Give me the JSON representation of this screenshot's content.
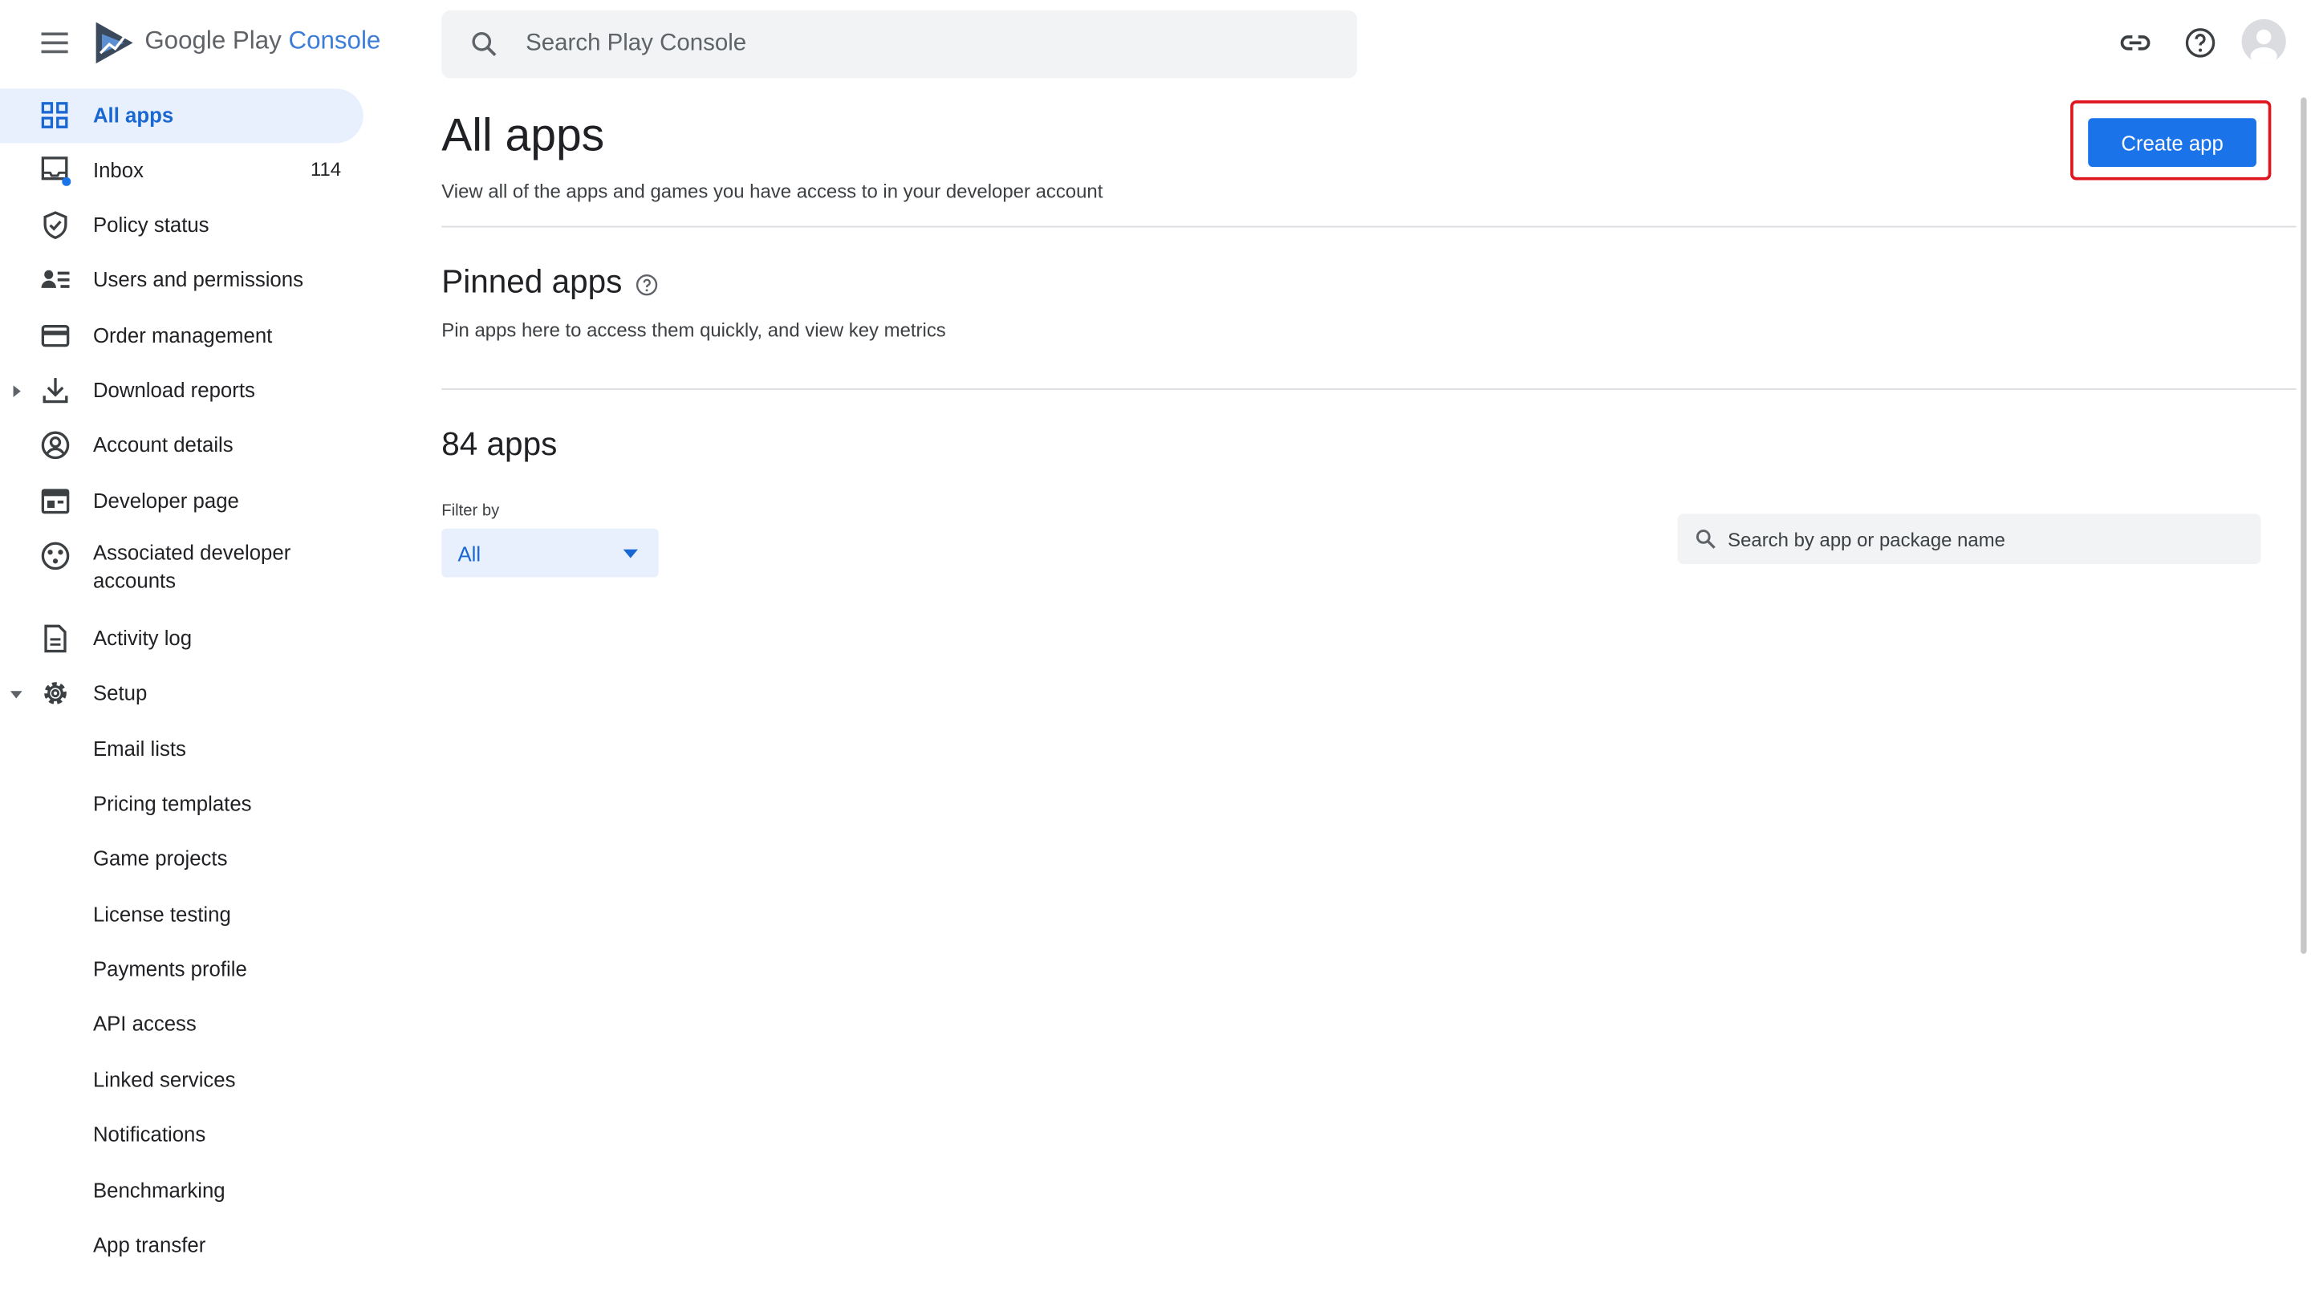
{
  "header": {
    "brand_primary": "Google Play",
    "brand_secondary": "Console",
    "search_placeholder": "Search Play Console",
    "icons": {
      "menu": "menu-icon",
      "link": "link-icon",
      "help": "help-icon",
      "avatar": "account-avatar"
    }
  },
  "sidebar": {
    "items": [
      {
        "label": "All apps",
        "icon": "grid-icon",
        "active": true
      },
      {
        "label": "Inbox",
        "icon": "inbox-icon",
        "count": "114"
      },
      {
        "label": "Policy status",
        "icon": "shield-icon"
      },
      {
        "label": "Users and permissions",
        "icon": "users-icon"
      },
      {
        "label": "Order management",
        "icon": "credit-card-icon"
      },
      {
        "label": "Download reports",
        "icon": "download-icon",
        "expandable": true
      },
      {
        "label": "Account details",
        "icon": "account-circle-icon"
      },
      {
        "label": "Developer page",
        "icon": "web-page-icon"
      },
      {
        "label": "Associated developer accounts",
        "icon": "associated-accounts-icon"
      },
      {
        "label": "Activity log",
        "icon": "document-icon"
      },
      {
        "label": "Setup",
        "icon": "gear-icon",
        "expanded": true
      }
    ],
    "setup_items": [
      "Email lists",
      "Pricing templates",
      "Game projects",
      "License testing",
      "Payments profile",
      "API access",
      "Linked services",
      "Notifications",
      "Benchmarking",
      "App transfer"
    ]
  },
  "main": {
    "title": "All apps",
    "subtitle": "View all of the apps and games you have access to in your developer account",
    "create_button": "Create app",
    "pinned": {
      "title": "Pinned apps",
      "subtitle": "Pin apps here to access them quickly, and view key metrics"
    },
    "apps_count": "84 apps",
    "filter": {
      "label": "Filter by",
      "value": "All"
    },
    "app_search_placeholder": "Search by app or package name"
  },
  "colors": {
    "accent": "#1a73e8",
    "active_bg": "#e8f0fe",
    "highlight": "#e0161e"
  }
}
